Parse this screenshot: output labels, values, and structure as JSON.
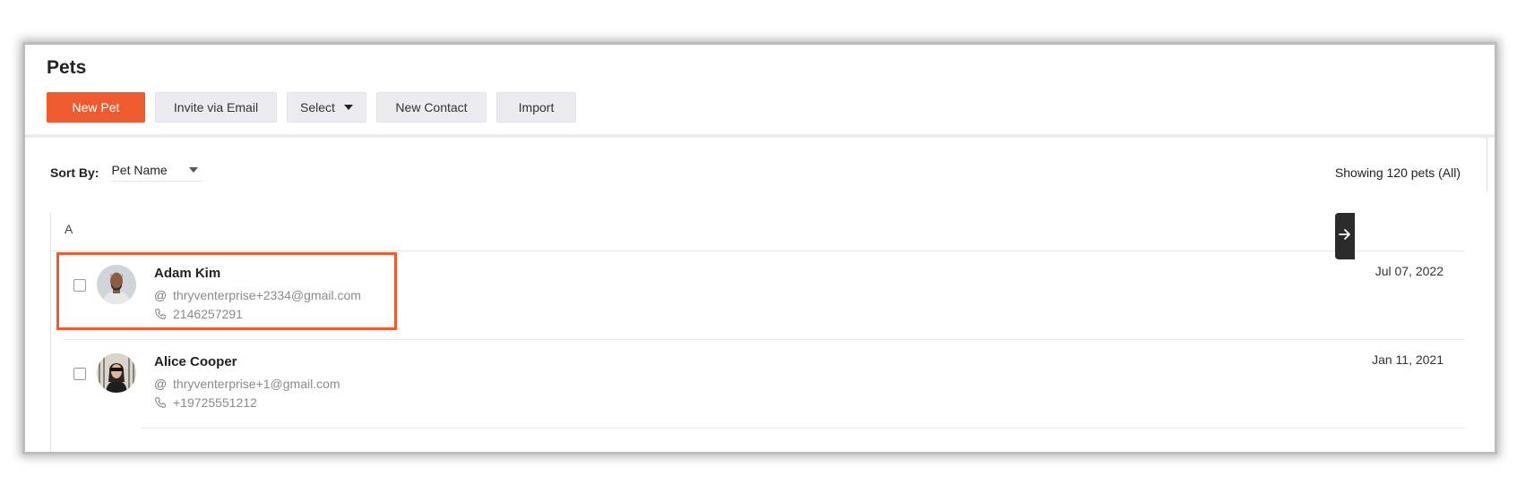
{
  "page": {
    "title": "Pets"
  },
  "toolbar": {
    "new_pet": "New Pet",
    "invite_email": "Invite via Email",
    "select": "Select",
    "new_contact": "New Contact",
    "import": "Import"
  },
  "sort": {
    "label": "Sort By:",
    "value": "Pet Name"
  },
  "summary": {
    "count_text": "Showing 120 pets (All)"
  },
  "list": {
    "group_letter": "A",
    "rows": [
      {
        "name": "Adam Kim",
        "email": "thryventerprise+2334@gmail.com",
        "phone": "2146257291",
        "date": "Jul 07, 2022",
        "highlighted": true
      },
      {
        "name": "Alice Cooper",
        "email": "thryventerprise+1@gmail.com",
        "phone": "+19725551212",
        "date": "Jan 11, 2021",
        "highlighted": false
      }
    ]
  },
  "colors": {
    "accent": "#ef5b2e",
    "highlight_border": "#ef5b2e",
    "drawer_tab": "#2b2b2b"
  },
  "icons": {
    "email": "at-icon",
    "phone": "phone-icon",
    "drawer": "arrow-right-icon",
    "dropdown": "caret-down-icon"
  }
}
